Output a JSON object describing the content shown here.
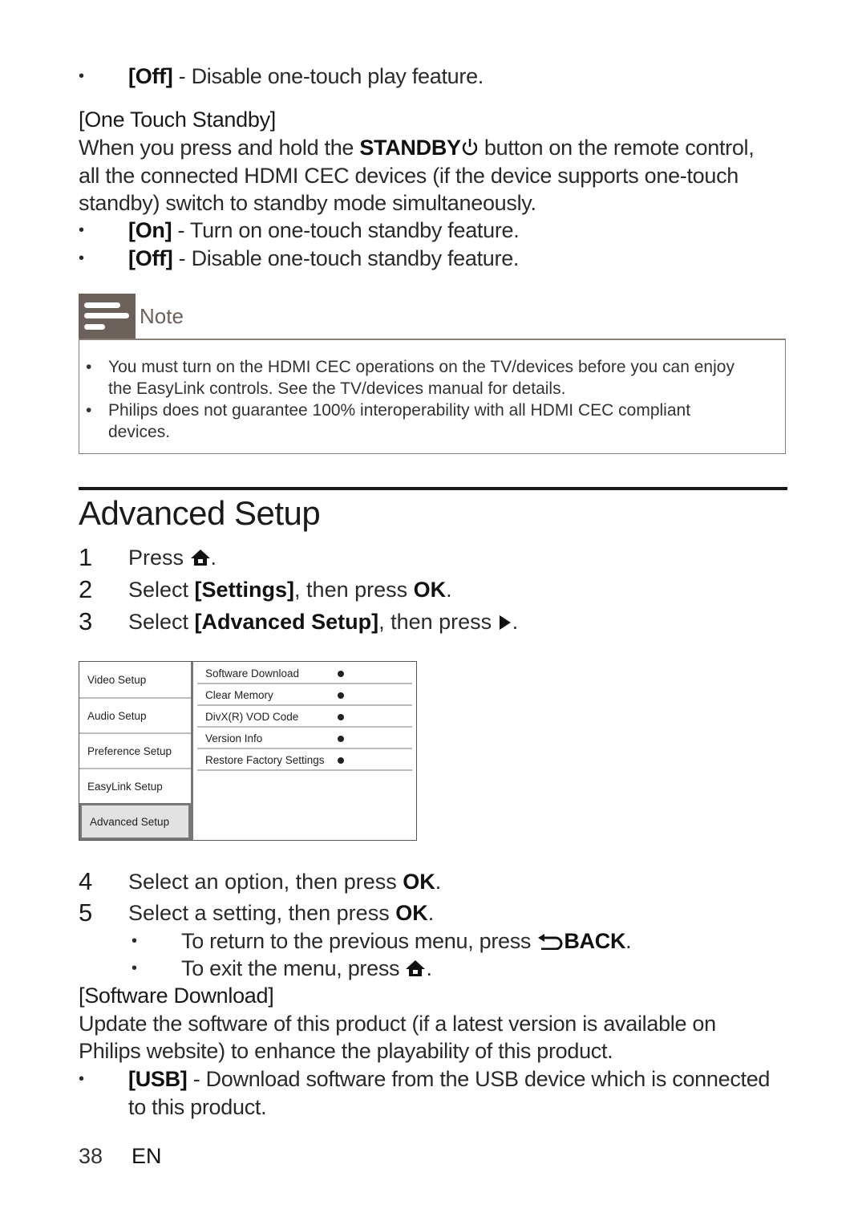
{
  "top_section": {
    "off_play": {
      "key": "[Off]",
      "text": " - Disable one-touch play feature."
    },
    "one_touch_standby": {
      "heading": "[One Touch Standby]",
      "para_line1_a": "When you press and hold the ",
      "para_line1_bold": "STANDBY",
      "para_line1_b": " button on the remote control,",
      "para_line2": "all the connected HDMI CEC devices (if the device supports one-touch",
      "para_line3": "standby) switch to standby mode simultaneously.",
      "options": [
        {
          "key": "[On]",
          "text": " - Turn on one-touch standby feature."
        },
        {
          "key": "[Off]",
          "text": " - Disable one-touch standby feature."
        }
      ]
    }
  },
  "note": {
    "label": "Note",
    "items": [
      {
        "line1": "You must turn on the HDMI CEC operations on the TV/devices before you can enjoy",
        "line2": "the EasyLink controls. See the TV/devices manual for details."
      },
      {
        "line1": "Philips does not guarantee 100% interoperability with all HDMI CEC compliant",
        "line2": "devices."
      }
    ]
  },
  "advanced_setup": {
    "title": "Advanced Setup",
    "steps": [
      {
        "num": "1",
        "a": "Press ",
        "icon": "home-icon",
        "b": "."
      },
      {
        "num": "2",
        "a": "Select ",
        "bold1": "[Settings]",
        "b": ", then press ",
        "bold2": "OK",
        "c": "."
      },
      {
        "num": "3",
        "a": "Select ",
        "bold1": "[Advanced Setup]",
        "b": ", then press ",
        "icon": "play-right-icon",
        "c": "."
      },
      {
        "num": "4",
        "a": "Select an option, then press ",
        "bold2": "OK",
        "c": "."
      },
      {
        "num": "5",
        "a": "Select a setting, then press ",
        "bold2": "OK",
        "c": "."
      }
    ],
    "sub_bullets": [
      {
        "a": "To return to the previous menu, press ",
        "icon": "back-icon",
        "bold": "BACK",
        "c": "."
      },
      {
        "a": "To exit the menu, press ",
        "icon": "home-icon",
        "c": "."
      }
    ],
    "menu": {
      "categories": [
        "Video Setup",
        "Audio Setup",
        "Preference Setup",
        "EasyLink Setup",
        "Advanced Setup"
      ],
      "selected_category": "Advanced Setup",
      "options": [
        "Software Download",
        "Clear Memory",
        "DivX(R) VOD Code",
        "Version Info",
        "Restore Factory Settings"
      ]
    }
  },
  "software_download": {
    "heading": "[Software Download]",
    "para_line1": "Update the software of this product (if a latest version is available on",
    "para_line2": "Philips website) to enhance the playability of this product.",
    "option": {
      "key": "[USB]",
      "line1": " - Download software from the USB device which is connected",
      "line2": "to this product."
    }
  },
  "footer": {
    "page_number": "38",
    "language": "EN"
  },
  "bullet_char": "•"
}
